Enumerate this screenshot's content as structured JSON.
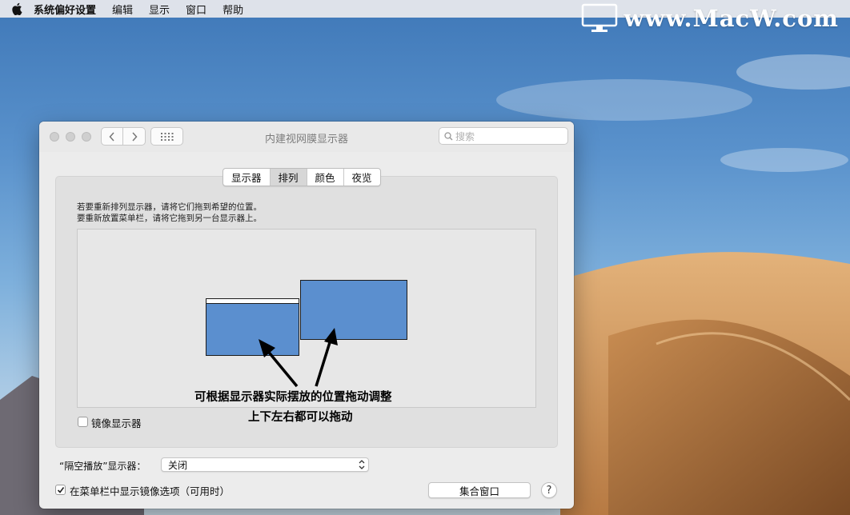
{
  "menubar": {
    "app_name": "系统偏好设置",
    "items": [
      "编辑",
      "显示",
      "窗口",
      "帮助"
    ]
  },
  "watermark": {
    "text": "www.MacW.com"
  },
  "window": {
    "title": "内建视网膜显示器",
    "search_placeholder": "搜索",
    "tabs": [
      {
        "label": "显示器",
        "selected": false
      },
      {
        "label": "排列",
        "selected": true
      },
      {
        "label": "颜色",
        "selected": false
      },
      {
        "label": "夜览",
        "selected": false
      }
    ],
    "instructions": [
      "若要重新排列显示器，请将它们拖到希望的位置。",
      "要重新放置菜单栏，请将它拖到另一台显示器上。"
    ],
    "annotation_line1": "可根据显示器实际摆放的位置拖动调整",
    "annotation_line2": "上下左右都可以拖动",
    "mirror_label": "镜像显示器",
    "mirror_checked": false,
    "airplay_label": "“隔空播放”显示器：",
    "airplay_value": "关闭",
    "menubar_option_label": "在菜单栏中显示镜像选项（可用时）",
    "menubar_option_checked": true,
    "gather_button": "集合窗口",
    "help_button": "?"
  },
  "colors": {
    "display_blue": "#5b8fcf",
    "window_bg": "#ececec"
  }
}
